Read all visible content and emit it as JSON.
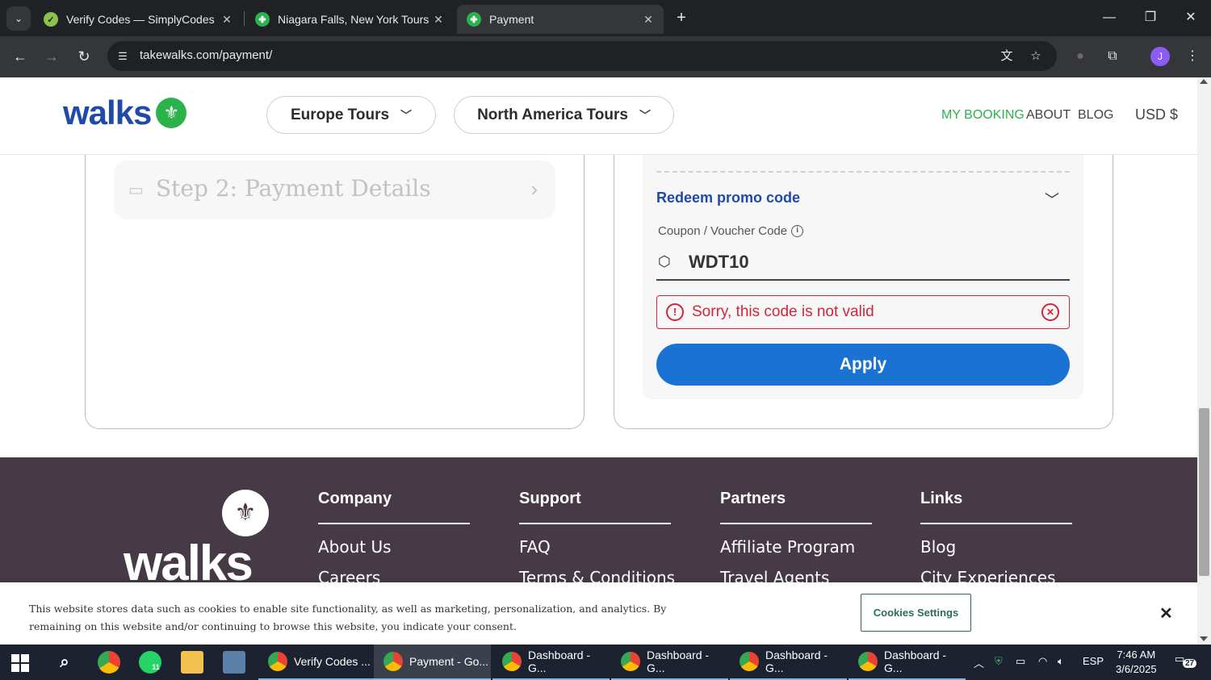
{
  "browser": {
    "tabs": [
      {
        "title": "Verify Codes — SimplyCodes",
        "active": false
      },
      {
        "title": "Niagara Falls, New York Tours &",
        "active": false
      },
      {
        "title": "Payment",
        "active": true
      }
    ],
    "url": "takewalks.com/payment/",
    "profile_initial": "J"
  },
  "site": {
    "logo": "walks",
    "nav": {
      "europe": "Europe Tours",
      "north_america": "North America Tours",
      "my_booking": "MY BOOKING",
      "about": "ABOUT",
      "blog": "BLOG",
      "currency": "USD $"
    },
    "accent_green": "#2bb24c",
    "brand_blue": "#1f4aa8"
  },
  "checkout": {
    "step2_label": "Step 2: Payment Details",
    "promo": {
      "heading": "Redeem promo code",
      "field_label": "Coupon / Voucher Code",
      "field_value": "WDT10",
      "error": "Sorry, this code is not valid",
      "apply_label": "Apply"
    },
    "error_color": "#d2253a",
    "apply_color": "#1a73d3"
  },
  "footer": {
    "logo": "walks",
    "columns": [
      {
        "heading": "Company",
        "links": [
          "About Us",
          "Careers"
        ]
      },
      {
        "heading": "Support",
        "links": [
          "FAQ",
          "Terms & Conditions"
        ]
      },
      {
        "heading": "Partners",
        "links": [
          "Affiliate Program",
          "Travel Agents"
        ]
      },
      {
        "heading": "Links",
        "links": [
          "Blog",
          "City Experiences"
        ]
      }
    ]
  },
  "cookie_banner": {
    "text": "This website stores data such as cookies to enable site functionality, as well as marketing, personalization, and analytics. By remaining on this website and/or continuing to browse this website, you indicate your consent.",
    "settings_label": "Cookies Settings"
  },
  "taskbar": {
    "whatsapp_badge": "11",
    "tasks": [
      {
        "label": "Verify Codes ...",
        "active": false
      },
      {
        "label": "Payment - Go...",
        "active": true
      },
      {
        "label": "Dashboard - G...",
        "active": false
      },
      {
        "label": "Dashboard - G...",
        "active": false
      },
      {
        "label": "Dashboard - G...",
        "active": false
      },
      {
        "label": "Dashboard - G...",
        "active": false
      }
    ],
    "language": "ESP",
    "time": "7:46 AM",
    "date": "3/6/2025",
    "notifications": "27"
  }
}
